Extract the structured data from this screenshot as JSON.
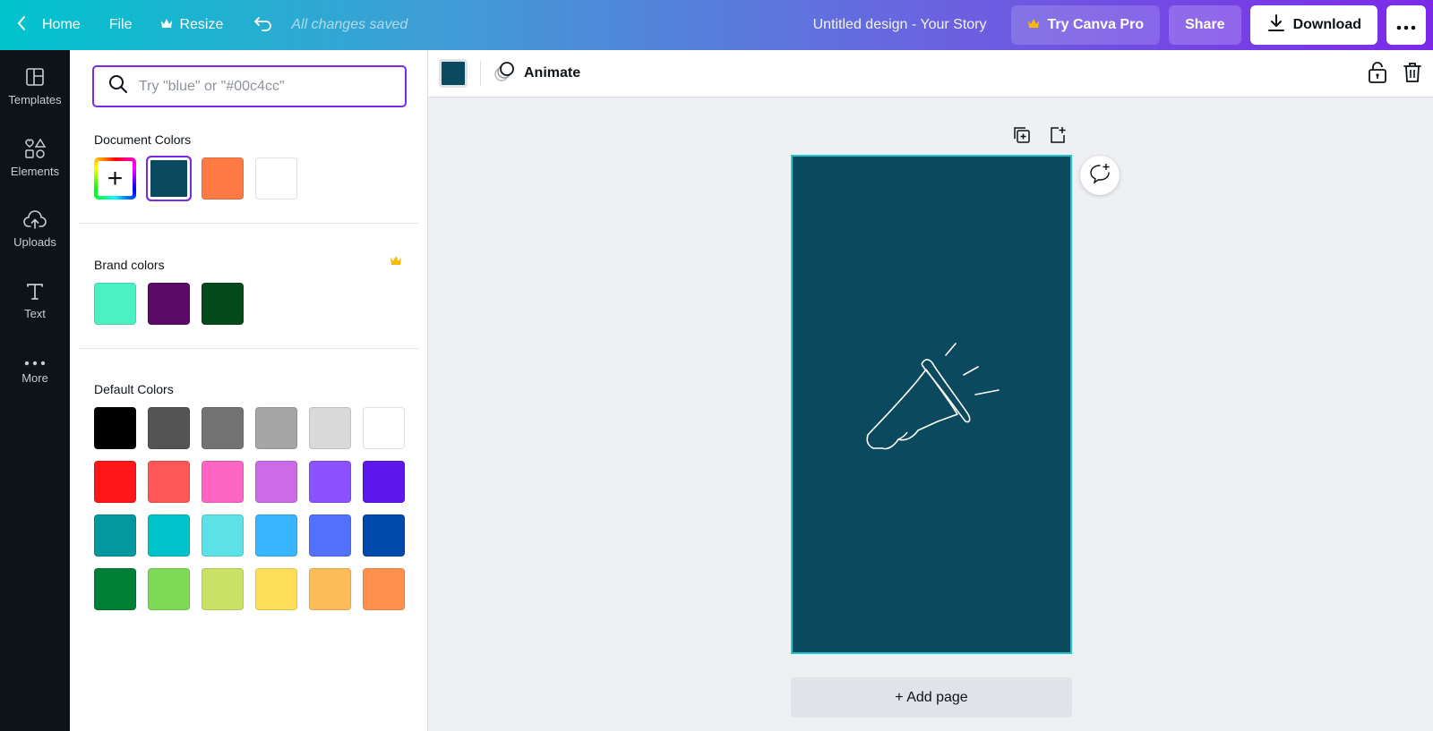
{
  "topbar": {
    "home_label": "Home",
    "file_label": "File",
    "resize_label": "Resize",
    "saved_status": "All changes saved",
    "design_title": "Untitled design - Your Story",
    "pro_label": "Try Canva Pro",
    "share_label": "Share",
    "download_label": "Download"
  },
  "sidebar": {
    "items": [
      {
        "label": "Templates",
        "icon": "templates-icon"
      },
      {
        "label": "Elements",
        "icon": "elements-icon"
      },
      {
        "label": "Uploads",
        "icon": "uploads-icon"
      },
      {
        "label": "Text",
        "icon": "text-icon"
      },
      {
        "label": "More",
        "icon": "more-icon"
      }
    ]
  },
  "color_panel": {
    "search_placeholder": "Try \"blue\" or \"#00c4cc\"",
    "document_title": "Document Colors",
    "document_colors": [
      "#0b4a5e",
      "#ff7a45",
      "#ffffff"
    ],
    "selected_color": "#0b4a5e",
    "brand_title": "Brand colors",
    "brand_colors": [
      "#4bf1c4",
      "#5c0a68",
      "#04491a"
    ],
    "default_title": "Default Colors",
    "default_colors": [
      [
        "#000000",
        "#545454",
        "#737373",
        "#a6a6a6",
        "#d9d9d9",
        "#ffffff"
      ],
      [
        "#ff1616",
        "#ff5757",
        "#ff66c4",
        "#cb6ce6",
        "#8c52ff",
        "#5e17eb"
      ],
      [
        "#03989e",
        "#00c2cb",
        "#5ce1e6",
        "#38b6ff",
        "#5271ff",
        "#004aad"
      ],
      [
        "#008037",
        "#7ed957",
        "#c9e265",
        "#ffde59",
        "#ffbd59",
        "#ff914d"
      ]
    ]
  },
  "toolbar": {
    "animate_label": "Animate",
    "current_color": "#0b4a5e"
  },
  "canvas": {
    "background": "#0b4a5e",
    "add_page_label": "+ Add page"
  },
  "colors": {
    "accent": "#7d2ae8",
    "crown": "#ffb800",
    "selection": "#20c4cc"
  }
}
